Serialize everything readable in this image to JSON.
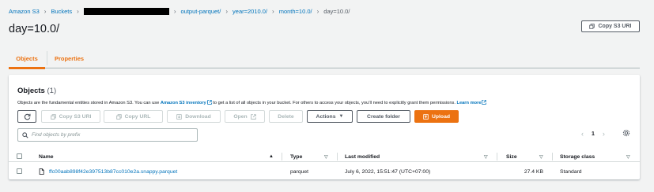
{
  "breadcrumb": {
    "root": "Amazon S3",
    "buckets": "Buckets",
    "folder1": "output-parquet/",
    "folder2": "year=2010.0/",
    "folder3": "month=10.0/",
    "current": "day=10.0/"
  },
  "page": {
    "title": "day=10.0/",
    "copy_uri_label": "Copy S3 URI"
  },
  "tabs": [
    "Objects",
    "Properties"
  ],
  "objects_panel": {
    "title": "Objects",
    "count": "(1)",
    "desc_before": "Objects are the fundamental entities stored in Amazon S3. You can use ",
    "desc_link": "Amazon S3 inventory",
    "desc_after": " to get a list of all objects in your bucket. For others to access your objects, you’ll need to explicitly grant them permissions. ",
    "learn_more": "Learn more"
  },
  "toolbar": {
    "copy_uri": "Copy S3 URI",
    "copy_url": "Copy URL",
    "download": "Download",
    "open": "Open",
    "delete": "Delete",
    "actions": "Actions",
    "create_folder": "Create folder",
    "upload": "Upload"
  },
  "search": {
    "placeholder": "Find objects by prefix"
  },
  "pagination": {
    "page": "1"
  },
  "table": {
    "headers": {
      "name": "Name",
      "type": "Type",
      "last_modified": "Last modified",
      "size": "Size",
      "storage_class": "Storage class"
    },
    "rows": [
      {
        "name": "ffc00aab898f42e397513b87cc010e2a.snappy.parquet",
        "type": "parquet",
        "last_modified": "July 6, 2022, 15:51:47 (UTC+07:00)",
        "size": "27.4 KB",
        "storage_class": "Standard"
      }
    ]
  },
  "colors": {
    "accent": "#ec7211",
    "link": "#0073bb"
  }
}
